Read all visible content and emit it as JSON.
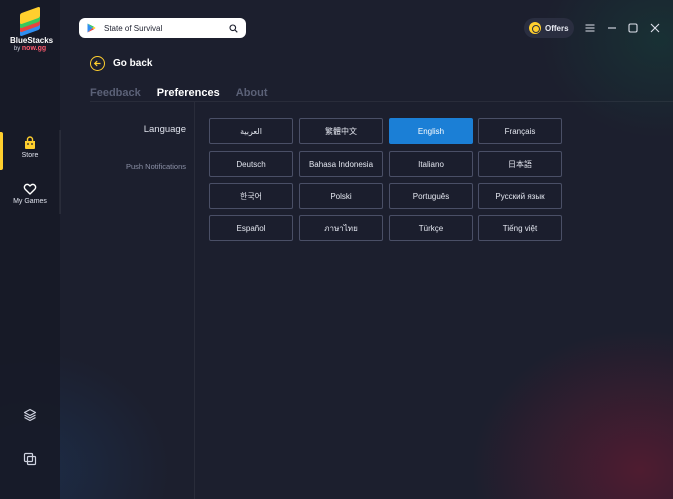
{
  "brand": {
    "name": "BlueStacks",
    "by": "by",
    "by_brand": "now.gg"
  },
  "sidebar": {
    "items": [
      {
        "label": "Store",
        "icon": "store-bag-icon"
      },
      {
        "label": "My Games",
        "icon": "heart-icon"
      }
    ],
    "bottom_icons": [
      "layers-icon",
      "multi-instance-icon"
    ]
  },
  "search": {
    "value": "State of Survival",
    "placeholder": ""
  },
  "offers": {
    "label": "Offers"
  },
  "nav": {
    "go_back": "Go back"
  },
  "tabs": [
    {
      "label": "Feedback",
      "active": false
    },
    {
      "label": "Preferences",
      "active": true
    },
    {
      "label": "About",
      "active": false
    }
  ],
  "settings": {
    "language_label": "Language",
    "push_label": "Push Notifications",
    "selected_language": "English",
    "languages": [
      "العربية",
      "繁體中文",
      "English",
      "Français",
      "Deutsch",
      "Bahasa Indonesia",
      "Italiano",
      "日本語",
      "한국어",
      "Polski",
      "Português",
      "Русский язык",
      "Español",
      "ภาษาไทย",
      "Türkçe",
      "Tiếng việt"
    ]
  },
  "colors": {
    "accent": "#ffcf2e",
    "selected": "#1b7fd6",
    "background": "#1c1f2e"
  }
}
